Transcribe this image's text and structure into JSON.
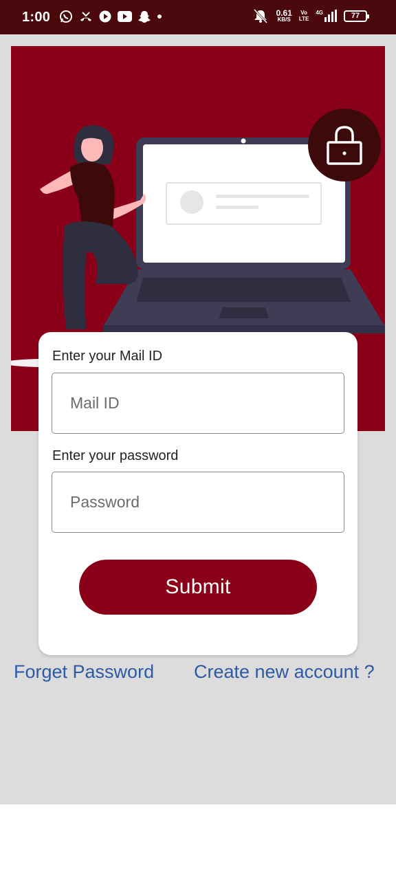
{
  "status_bar": {
    "time": "1:00",
    "net_speed_value": "0.61",
    "net_speed_unit": "KB/S",
    "volte_top": "Vo",
    "volte_bottom": "LTE",
    "network": "4G",
    "battery": "77",
    "left_icons": [
      "whatsapp-icon",
      "missed-call-icon",
      "play-icon",
      "youtube-icon",
      "snapchat-icon",
      "dot-icon"
    ],
    "right_icons": [
      "mute-icon",
      "signal-icon",
      "battery-icon"
    ]
  },
  "form": {
    "mail_label": "Enter your Mail ID",
    "mail_placeholder": "Mail ID",
    "password_label": "Enter your password",
    "password_placeholder": "Password",
    "submit_label": "Submit"
  },
  "links": {
    "forget_password": "Forget Password",
    "create_account": "Create new account ?"
  },
  "colors": {
    "status_bar": "#4a0a0d",
    "brand": "#8b0019",
    "lock_badge": "#3d0a0c",
    "link": "#2d5aa4",
    "background": "#dcdcdc"
  }
}
